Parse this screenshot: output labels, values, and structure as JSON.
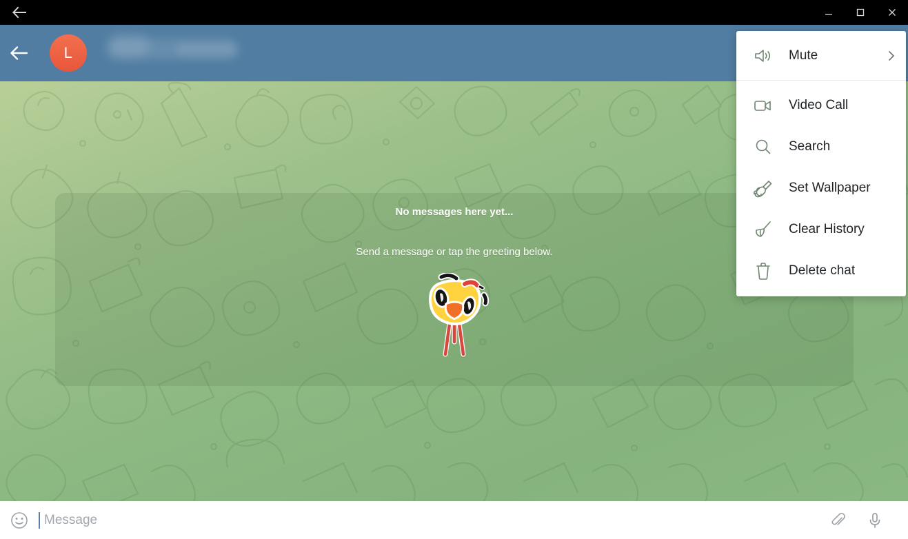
{
  "window": {
    "back_icon": "arrow-left-icon",
    "minimize_label": "minimize",
    "maximize_label": "maximize",
    "close_label": "close"
  },
  "chat_header": {
    "back_icon": "arrow-left-icon",
    "avatar_initial": "L",
    "avatar_color": "#ec5e3f",
    "contact_name": "",
    "background_color": "#517da2"
  },
  "chat_body": {
    "empty_title": "No messages here yet...",
    "empty_subtitle": "Send a message or tap the greeting below.",
    "greeting_sticker": "duck-sticker",
    "wallpaper_colors": [
      "#b9cf98",
      "#8cb882",
      "#86b37e"
    ]
  },
  "input_bar": {
    "emoji_icon": "smiley-icon",
    "placeholder": "Message",
    "value": "",
    "attach_icon": "paperclip-icon",
    "voice_icon": "microphone-icon"
  },
  "context_menu": {
    "items": [
      {
        "label": "Mute",
        "icon": "speaker-icon",
        "has_submenu": true
      },
      {
        "label": "Video Call",
        "icon": "video-camera-icon",
        "has_submenu": false
      },
      {
        "label": "Search",
        "icon": "magnifier-icon",
        "has_submenu": false
      },
      {
        "label": "Set Wallpaper",
        "icon": "paint-roller-icon",
        "has_submenu": false
      },
      {
        "label": "Clear History",
        "icon": "broom-icon",
        "has_submenu": false
      },
      {
        "label": "Delete chat",
        "icon": "trash-icon",
        "has_submenu": false
      }
    ]
  }
}
